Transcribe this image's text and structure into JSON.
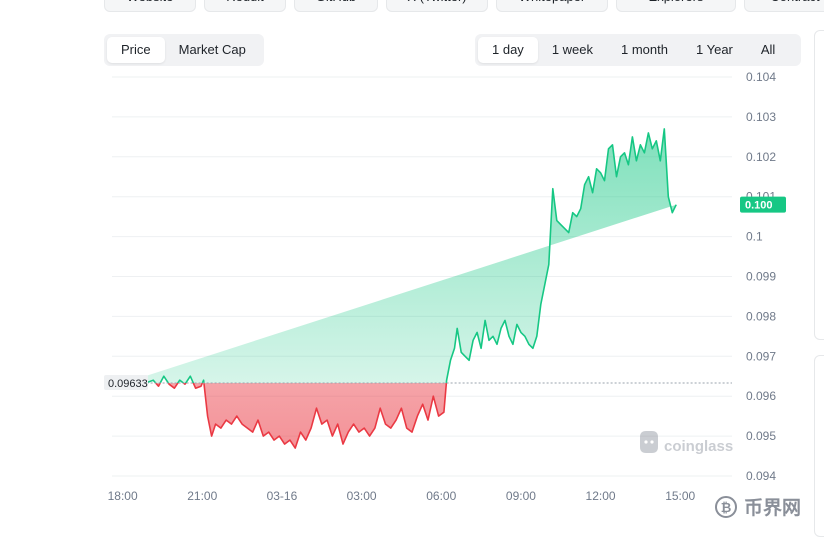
{
  "top_links": [
    "Website",
    "Reddit",
    "GitHub",
    "X (Twitter)",
    "Whitepaper",
    "Explorers",
    "Contract"
  ],
  "metric_tabs": [
    {
      "label": "Price",
      "active": true
    },
    {
      "label": "Market Cap",
      "active": false
    }
  ],
  "range_tabs": [
    {
      "label": "1 day",
      "active": true
    },
    {
      "label": "1 week",
      "active": false
    },
    {
      "label": "1 month",
      "active": false
    },
    {
      "label": "1 Year",
      "active": false
    },
    {
      "label": "All",
      "active": false
    }
  ],
  "watermark": "coinglass",
  "site_logo_text": "币界网",
  "colors": {
    "up": "#16c784",
    "down": "#ea3943",
    "grid": "#eef0f2",
    "axis_text": "#707a8a"
  },
  "chart_data": {
    "type": "area",
    "baseline": 0.09633,
    "baseline_label": "0.09633",
    "last_price_label": "0.100",
    "ylim": [
      0.094,
      0.104
    ],
    "yticks": [
      0.094,
      0.095,
      0.096,
      0.097,
      0.098,
      0.099,
      0.1,
      0.101,
      0.102,
      0.103,
      0.104
    ],
    "ytick_labels": [
      "0.094",
      "0.095",
      "0.096",
      "0.097",
      "0.098",
      "0.099",
      "0.1",
      "0.101",
      "0.102",
      "0.103",
      "0.104"
    ],
    "xlim": [
      17.6,
      16.6
    ],
    "xticks": [
      18,
      21,
      24,
      27,
      30,
      33,
      36,
      39
    ],
    "xtick_labels": [
      "18:00",
      "21:00",
      "03-16",
      "03:00",
      "06:00",
      "09:00",
      "12:00",
      "15:00"
    ],
    "x": [
      18.15,
      18.35,
      18.55,
      18.75,
      18.95,
      19.15,
      19.35,
      19.55,
      19.75,
      19.95,
      20.15,
      20.35,
      20.55,
      20.75,
      20.95,
      21.05,
      21.2,
      21.35,
      21.5,
      21.7,
      21.9,
      22.1,
      22.3,
      22.5,
      22.7,
      22.9,
      23.1,
      23.3,
      23.5,
      23.7,
      23.9,
      24.1,
      24.3,
      24.5,
      24.7,
      24.9,
      25.1,
      25.3,
      25.5,
      25.7,
      25.9,
      26.1,
      26.3,
      26.5,
      26.7,
      26.9,
      27.1,
      27.3,
      27.5,
      27.7,
      27.9,
      28.1,
      28.3,
      28.5,
      28.7,
      28.9,
      29.1,
      29.3,
      29.5,
      29.7,
      29.9,
      30.1,
      30.2,
      30.35,
      30.5,
      30.6,
      30.75,
      30.9,
      31.05,
      31.2,
      31.35,
      31.5,
      31.65,
      31.8,
      31.95,
      32.1,
      32.25,
      32.4,
      32.55,
      32.7,
      32.85,
      33.0,
      33.15,
      33.3,
      33.45,
      33.6,
      33.75,
      33.9,
      34.05,
      34.2,
      34.35,
      34.5,
      34.65,
      34.8,
      34.95,
      35.1,
      35.25,
      35.4,
      35.55,
      35.7,
      35.85,
      36.0,
      36.15,
      36.3,
      36.45,
      36.6,
      36.75,
      36.9,
      37.05,
      37.2,
      37.35,
      37.5,
      37.65,
      37.8,
      37.95,
      38.1,
      38.25,
      38.4,
      38.55,
      38.7,
      38.85,
      39.0,
      39.15,
      39.3,
      39.45,
      39.6,
      39.75,
      39.9,
      40.05,
      40.2,
      40.35,
      40.5,
      40.65,
      40.8,
      40.95
    ],
    "y": [
      0.09635,
      0.0963,
      0.0962,
      0.09625,
      0.09635,
      0.0964,
      0.09625,
      0.0965,
      0.0963,
      0.0962,
      0.0964,
      0.0963,
      0.0965,
      0.0962,
      0.09625,
      0.0964,
      0.0955,
      0.095,
      0.0953,
      0.0952,
      0.0954,
      0.0953,
      0.0955,
      0.0953,
      0.0952,
      0.0951,
      0.0954,
      0.095,
      0.0951,
      0.0949,
      0.095,
      0.0948,
      0.0949,
      0.0947,
      0.0951,
      0.0949,
      0.0952,
      0.0957,
      0.0953,
      0.0954,
      0.095,
      0.0953,
      0.0948,
      0.0951,
      0.0953,
      0.0951,
      0.0952,
      0.095,
      0.0952,
      0.0957,
      0.0953,
      0.0952,
      0.0954,
      0.0957,
      0.0952,
      0.0951,
      0.0955,
      0.0958,
      0.0954,
      0.096,
      0.0955,
      0.0956,
      0.0964,
      0.0969,
      0.0972,
      0.0977,
      0.0971,
      0.097,
      0.0969,
      0.0974,
      0.0976,
      0.0972,
      0.0979,
      0.0974,
      0.0975,
      0.0973,
      0.0977,
      0.0979,
      0.0975,
      0.0973,
      0.0978,
      0.0976,
      0.0975,
      0.0973,
      0.0972,
      0.0975,
      0.0983,
      0.0988,
      0.0993,
      0.1012,
      0.1004,
      0.1003,
      0.1002,
      0.1001,
      0.1006,
      0.1005,
      0.1007,
      0.1013,
      0.1015,
      0.1011,
      0.1017,
      0.1016,
      0.1014,
      0.1022,
      0.1023,
      0.1015,
      0.102,
      0.1021,
      0.1018,
      0.1025,
      0.1019,
      0.1023,
      0.1021,
      0.1026,
      0.1022,
      0.1024,
      0.1019,
      0.1027,
      0.101,
      0.1006,
      0.1008
    ]
  }
}
